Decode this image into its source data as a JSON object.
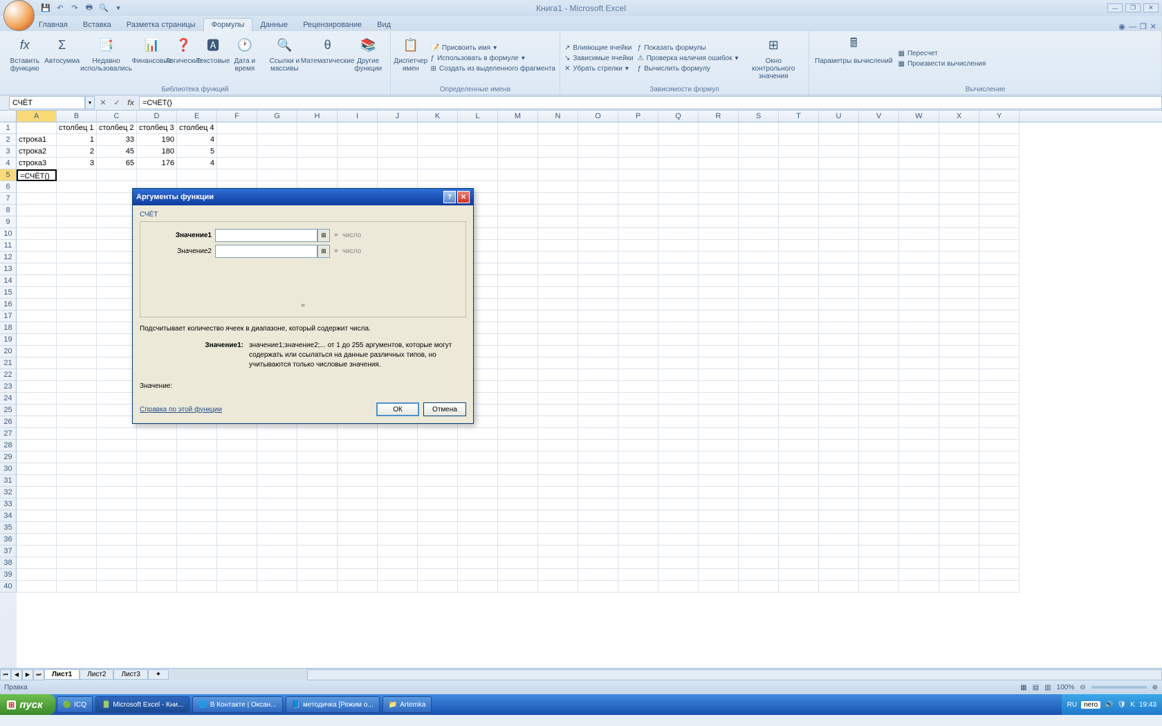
{
  "window_title": "Книга1 - Microsoft Excel",
  "tabs": [
    "Главная",
    "Вставка",
    "Разметка страницы",
    "Формулы",
    "Данные",
    "Рецензирование",
    "Вид"
  ],
  "active_tab": 3,
  "ribbon": {
    "g1": {
      "label": "Библиотека функций",
      "btns": [
        "Вставить функцию",
        "Автосумма",
        "Недавно использовались",
        "Финансовые",
        "Логические",
        "Текстовые",
        "Дата и время",
        "Ссылки и массивы",
        "Математические",
        "Другие функции"
      ]
    },
    "g2": {
      "label": "Определенные имена",
      "btn": "Диспетчер имен",
      "items": [
        "Присвоить имя",
        "Использовать в формуле",
        "Создать из выделенного фрагмента"
      ]
    },
    "g3": {
      "label": "Зависимости формул",
      "items": [
        "Влияющие ячейки",
        "Зависимые ячейки",
        "Убрать стрелки",
        "Показать формулы",
        "Проверка наличия ошибок",
        "Вычислить формулу"
      ],
      "btn": "Окно контрольного значения"
    },
    "g4": {
      "label": "Вычисление",
      "btn": "Параметры вычислений",
      "items": [
        "Пересчет",
        "Произвести вычисления"
      ]
    }
  },
  "namebox": "СЧЁТ",
  "formula": "=СЧЁТ()",
  "columns": [
    "A",
    "B",
    "C",
    "D",
    "E",
    "F",
    "G",
    "H",
    "I",
    "J",
    "K",
    "L",
    "M",
    "N",
    "O",
    "P",
    "Q",
    "R",
    "S",
    "T",
    "U",
    "V",
    "W",
    "X",
    "Y"
  ],
  "sheet_data": {
    "headers": [
      "столбец 1",
      "столбец 2",
      "столбец 3",
      "столбец 4"
    ],
    "rows": [
      {
        "label": "строка1",
        "v": [
          "1",
          "33",
          "190",
          "4"
        ]
      },
      {
        "label": "строка2",
        "v": [
          "2",
          "45",
          "180",
          "5"
        ]
      },
      {
        "label": "строка3",
        "v": [
          "3",
          "65",
          "176",
          "4"
        ]
      }
    ],
    "active_cell": "=СЧЁТ()"
  },
  "dialog": {
    "title": "Аргументы функции",
    "fn": "СЧЁТ",
    "arg1_label": "Значение1",
    "arg2_label": "Значение2",
    "hint_num": "число",
    "eq": "=",
    "desc": "Подсчитывает количество ячеек в диапазоне, который содержит числа.",
    "arg_title": "Значение1:",
    "arg_desc": "значение1;значение2;... от 1 до 255 аргументов, которые могут содержать или ссылаться на данные различных типов, но учитываются только числовые значения.",
    "value_label": "Значение:",
    "help": "Справка по этой функции",
    "ok": "ОК",
    "cancel": "Отмена"
  },
  "sheets": [
    "Лист1",
    "Лист2",
    "Лист3"
  ],
  "status": "Правка",
  "zoom": "100%",
  "taskbar": {
    "start": "пуск",
    "items": [
      "ICQ",
      "Microsoft Excel - Кни...",
      "В Контакте | Оксан...",
      "методичка [Режим о...",
      "Artemka"
    ],
    "lang": "RU",
    "time": "19:43"
  },
  "icons": {
    "sigma": "Σ",
    "fx": "fx"
  }
}
